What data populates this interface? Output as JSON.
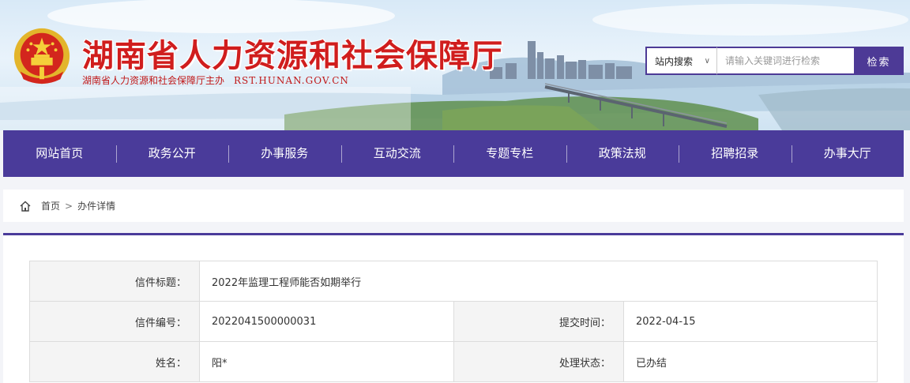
{
  "header": {
    "site_title": "湖南省人力资源和社会保障厅",
    "sponsor": "湖南省人力资源和社会保障厅主办",
    "domain": "RST.HUNAN.GOV.CN"
  },
  "search": {
    "scope_label": "站内搜索",
    "placeholder": "请输入关键词进行检索",
    "button_label": "检索"
  },
  "nav": {
    "items": [
      "网站首页",
      "政务公开",
      "办事服务",
      "互动交流",
      "专题专栏",
      "政策法规",
      "招聘招录",
      "办事大厅"
    ]
  },
  "breadcrumb": {
    "home": "首页",
    "separator": ">",
    "current": "办件详情"
  },
  "letter": {
    "title_label": "信件标题：",
    "title_value": "2022年监理工程师能否如期举行",
    "number_label": "信件编号：",
    "number_value": "2022041500000031",
    "submit_time_label": "提交时间：",
    "submit_time_value": "2022-04-15",
    "name_label": "姓名：",
    "name_value": "阳*",
    "status_label": "处理状态：",
    "status_value": "已办结"
  },
  "colors": {
    "brand_purple": "#4a3b9a",
    "title_red": "#d01d1d"
  }
}
